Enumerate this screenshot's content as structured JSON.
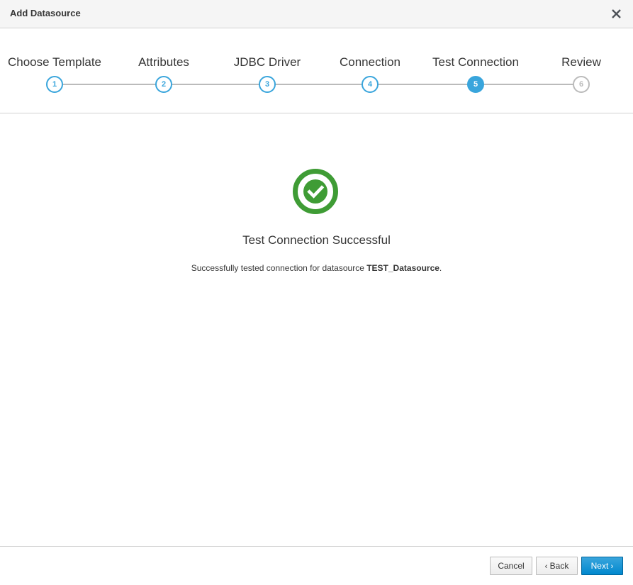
{
  "dialog": {
    "title": "Add Datasource"
  },
  "wizard": {
    "steps": [
      {
        "label": "Choose Template",
        "number": "1",
        "state": "complete"
      },
      {
        "label": "Attributes",
        "number": "2",
        "state": "complete"
      },
      {
        "label": "JDBC Driver",
        "number": "3",
        "state": "complete"
      },
      {
        "label": "Connection",
        "number": "4",
        "state": "complete"
      },
      {
        "label": "Test Connection",
        "number": "5",
        "state": "active"
      },
      {
        "label": "Review",
        "number": "6",
        "state": "future"
      }
    ]
  },
  "result": {
    "title": "Test Connection Successful",
    "message_prefix": "Successfully tested connection for datasource ",
    "datasource_name": "TEST_Datasource",
    "message_suffix": ".",
    "icon": "check-circle-icon"
  },
  "footer": {
    "cancel_label": "Cancel",
    "back_label": "Back",
    "next_label": "Next",
    "back_icon": "‹",
    "next_icon": "›"
  },
  "colors": {
    "accent": "#39a5dc",
    "success": "#3f9c35",
    "primary_button": "#0088ce",
    "inactive": "#bbbbbb"
  }
}
